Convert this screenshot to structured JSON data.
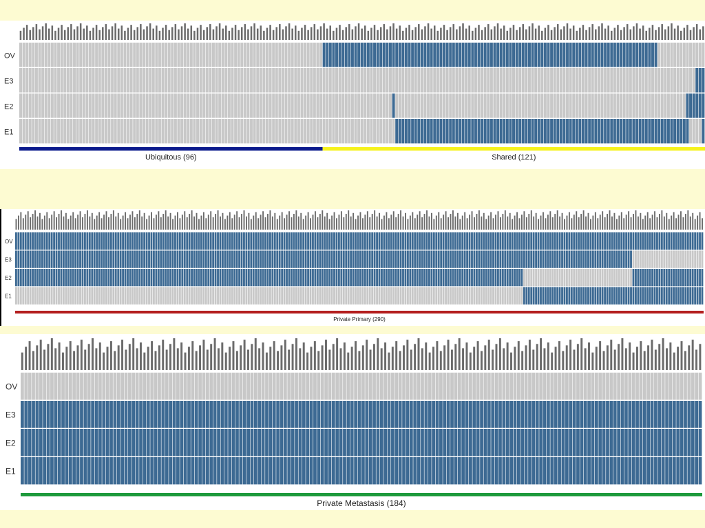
{
  "colors": {
    "page_background": "#fdfbd2",
    "absent": "#c8c8c8",
    "present": "#3d6a93",
    "cell_border": "#ffffff"
  },
  "chart_data": [
    {
      "type": "heatmap",
      "rows": [
        "OV",
        "E3",
        "E2",
        "E1"
      ],
      "groups": [
        {
          "label": "Ubiquitous (96)",
          "color": "#0b1a8c",
          "count": 96
        },
        {
          "label": "Shared (121)",
          "color": "#f6f21b",
          "count": 121
        }
      ],
      "total_columns": 217,
      "presence": {
        "OV": [
          [
            96,
            202
          ]
        ],
        "E3": [
          [
            214,
            217
          ]
        ],
        "E2": [
          [
            118,
            119
          ],
          [
            211,
            217
          ]
        ],
        "E1": [
          [
            119,
            212
          ],
          [
            216,
            217
          ]
        ]
      }
    },
    {
      "type": "heatmap",
      "rows": [
        "OV",
        "E3",
        "E2",
        "E1"
      ],
      "groups": [
        {
          "label": "Private Primary (290)",
          "color": "#b41e1e",
          "count": 290
        }
      ],
      "total_columns": 290,
      "presence": {
        "OV": [
          [
            0,
            290
          ]
        ],
        "E3": [
          [
            0,
            260
          ]
        ],
        "E2": [
          [
            0,
            214
          ],
          [
            260,
            290
          ]
        ],
        "E1": [
          [
            214,
            290
          ]
        ]
      }
    },
    {
      "type": "heatmap",
      "rows": [
        "OV",
        "E3",
        "E2",
        "E1"
      ],
      "groups": [
        {
          "label": "Private Metastasis (184)",
          "color": "#1e9a3c",
          "count": 184
        }
      ],
      "total_columns": 184,
      "presence": {
        "OV": [],
        "E3": [
          [
            0,
            184
          ]
        ],
        "E2": [
          [
            0,
            184
          ]
        ],
        "E1": [
          [
            0,
            184
          ]
        ]
      }
    }
  ]
}
